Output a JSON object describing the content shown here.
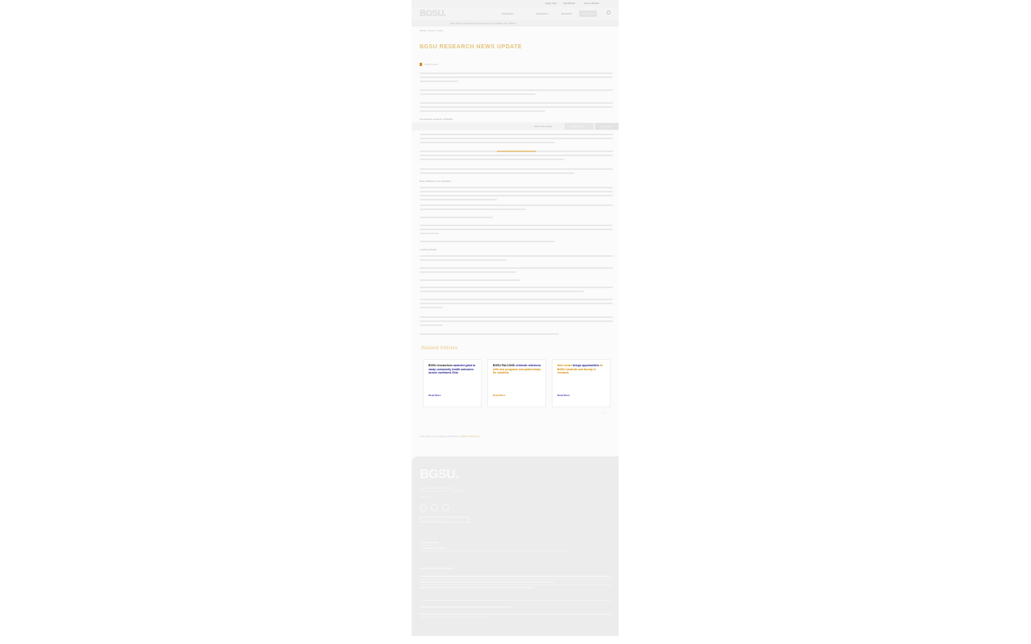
{
  "utility": {
    "links": [
      "Apply Now",
      "Visit BGSU",
      "Give to BGSU"
    ]
  },
  "header": {
    "logo": "BGSU.",
    "nav": [
      "Academics",
      "Admissions",
      "Research",
      "About"
    ],
    "apply_label": "Apply Now"
  },
  "alert": {
    "text": "Stay informed about the latest news and updates from BGSU."
  },
  "breadcrumb": "BGSU › News › Article",
  "article": {
    "title": "BGSU RESEARCH NEWS UPDATE",
    "byline": "BGSU News"
  },
  "sticky": {
    "label": "Share this article",
    "btn1": "Request Info",
    "btn2": "Apply Now"
  },
  "headings": [
    "Continued research at BGSU",
    "New initiatives for students",
    "Looking ahead"
  ],
  "related": {
    "heading": "Related Articles",
    "cards": [
      {
        "pre": "BGSU researchers ",
        "link": "awarded grant to study",
        "post": " community health outcomes across northwest Ohio",
        "more": "Read More"
      },
      {
        "pre": "BGSU FALCONS ",
        "link": "celebrate milestone",
        "post": " with new programs and partnerships for students",
        "more": "Read More"
      },
      {
        "pre": "New center ",
        "link": "brings opportunities",
        "post": " to BGSU students and faculty in research",
        "more": "Read More"
      }
    ]
  },
  "source": {
    "text": "This article was originally published by ",
    "link": "BGSU Marketing"
  },
  "footer": {
    "logo": "BGSU.",
    "address": "Bowling Green State University",
    "phone": "Bowling Green, OH 43403 · 419-372-2531",
    "follow": "Follow Us",
    "cta": "Connect with BGSU"
  }
}
